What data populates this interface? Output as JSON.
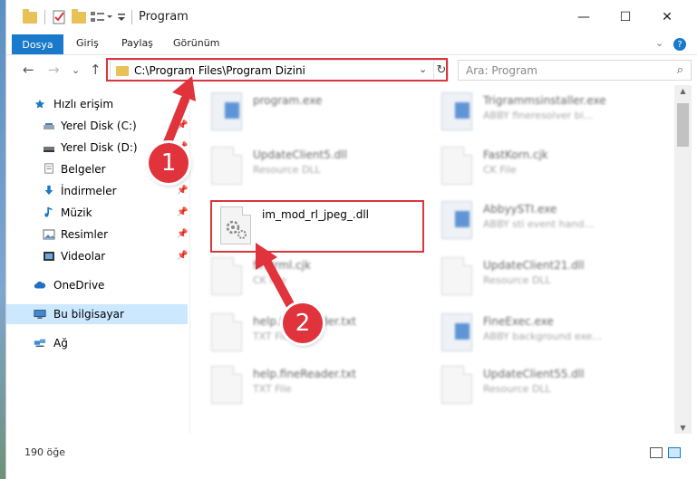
{
  "window": {
    "title": "Program",
    "minimize": "—",
    "maximize": "☐",
    "close": "✕"
  },
  "ribbon": {
    "file_tab": "Dosya",
    "tabs": [
      "Giriş",
      "Paylaş",
      "Görünüm"
    ],
    "collapse": "⌄",
    "help": "?"
  },
  "nav": {
    "back": "←",
    "forward": "→",
    "recent": "⌄",
    "up": "↑",
    "address": "C:\\Program Files\\Program Dizini",
    "address_dropdown": "⌄",
    "refresh": "↻",
    "search_placeholder": "Ara: Program",
    "search_icon": "⌕"
  },
  "sidebar": {
    "items": [
      {
        "label": "Hızlı erişim",
        "icon": "star-icon",
        "pinned": false
      },
      {
        "label": "Yerel Disk (C:)",
        "icon": "disk-icon",
        "pinned": true
      },
      {
        "label": "Yerel Disk (D:)",
        "icon": "disk-icon",
        "pinned": true
      },
      {
        "label": "Belgeler",
        "icon": "documents-icon",
        "pinned": true
      },
      {
        "label": "İndirmeler",
        "icon": "download-icon",
        "pinned": true
      },
      {
        "label": "Müzik",
        "icon": "music-icon",
        "pinned": true
      },
      {
        "label": "Resimler",
        "icon": "pictures-icon",
        "pinned": true
      },
      {
        "label": "Videolar",
        "icon": "videos-icon",
        "pinned": true
      },
      {
        "label": "OneDrive",
        "icon": "cloud-icon",
        "pinned": false
      },
      {
        "label": "Bu bilgisayar",
        "icon": "computer-icon",
        "pinned": false,
        "selected": true
      },
      {
        "label": "Ağ",
        "icon": "network-icon",
        "pinned": false
      }
    ]
  },
  "files": [
    {
      "name": "program.exe",
      "type": "",
      "kind": "exe",
      "blurred": true
    },
    {
      "name": "Trigrammsinstaller.exe",
      "type": "ABBY fineresolver bi...",
      "kind": "exe",
      "blurred": true
    },
    {
      "name": "UpdateClient5.dll",
      "type": "Resource DLL",
      "kind": "dll",
      "blurred": true
    },
    {
      "name": "FastKorn.cjk",
      "type": "CK File",
      "kind": "doc",
      "blurred": true
    },
    {
      "name": "im_mod_rl_jpeg_.dll",
      "type": "",
      "kind": "dll",
      "blurred": false
    },
    {
      "name": "AbbyySTI.exe",
      "type": "ABBY sti event hand...",
      "kind": "exe",
      "blurred": true
    },
    {
      "name": "firstrml.cjk",
      "type": "CK File",
      "kind": "doc",
      "blurred": true
    },
    {
      "name": "UpdateClient21.dll",
      "type": "Resource DLL",
      "kind": "dll",
      "blurred": true
    },
    {
      "name": "help.fineReader.txt",
      "type": "TXT File",
      "kind": "doc",
      "blurred": true
    },
    {
      "name": "FineExec.exe",
      "type": "ABBY background exe...",
      "kind": "exe",
      "blurred": true
    },
    {
      "name": "help.fineReader.txt",
      "type": "TXT File",
      "kind": "doc",
      "blurred": true
    },
    {
      "name": "UpdateClient55.dll",
      "type": "Resource DLL",
      "kind": "dll",
      "blurred": true
    }
  ],
  "status": {
    "item_count": "190 öğe"
  },
  "annotations": {
    "badge1": "1",
    "badge2": "2"
  },
  "colors": {
    "accent": "#1979ca",
    "annotation_red": "#d9363e",
    "selection": "#cce8ff"
  }
}
